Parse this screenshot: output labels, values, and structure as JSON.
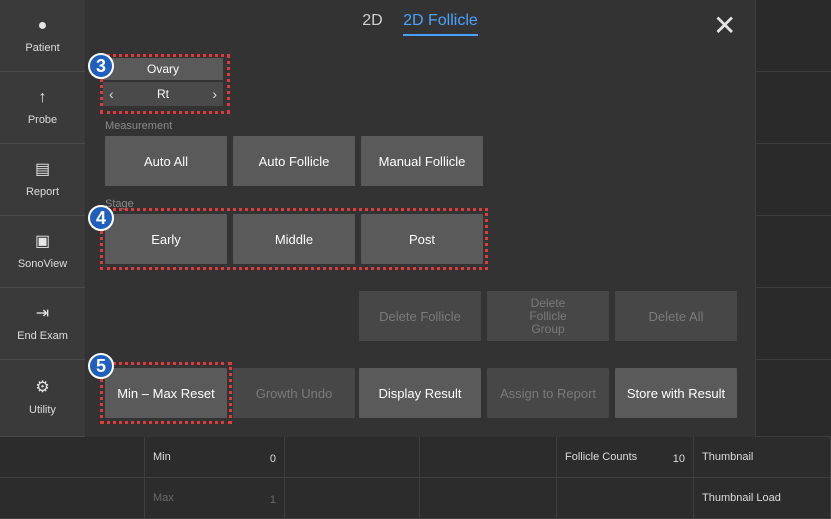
{
  "sidebar": {
    "items": [
      {
        "label": "Patient",
        "icon": "person-icon"
      },
      {
        "label": "Probe",
        "icon": "probe-icon"
      },
      {
        "label": "Report",
        "icon": "document-icon"
      },
      {
        "label": "SonoView",
        "icon": "sonoview-icon"
      },
      {
        "label": "End Exam",
        "icon": "exit-icon"
      },
      {
        "label": "Utility",
        "icon": "gear-icon"
      }
    ]
  },
  "header": {
    "tabs": [
      "2D",
      "2D Follicle"
    ],
    "active_tab": "2D Follicle"
  },
  "ovary": {
    "title": "Ovary",
    "value": "Rt"
  },
  "measurement": {
    "label": "Measurement",
    "buttons": [
      "Auto All",
      "Auto Follicle",
      "Manual Follicle"
    ]
  },
  "stage": {
    "label": "Stage",
    "buttons": [
      "Early",
      "Middle",
      "Post"
    ]
  },
  "delete": {
    "buttons": [
      "Delete Follicle",
      "Delete Follicle Group",
      "Delete All"
    ]
  },
  "actions": {
    "buttons": [
      "Min – Max Reset",
      "Growth Undo",
      "Display Result",
      "Assign to Report",
      "Store with Result"
    ]
  },
  "badges": [
    "3",
    "4",
    "5"
  ],
  "bottom": {
    "min_label": "Min",
    "min_value": "0",
    "max_label": "Max",
    "max_value": "1",
    "follicle_counts_label": "Follicle Counts",
    "follicle_counts_value": "10",
    "thumbnail_label": "Thumbnail",
    "thumbnail_load_label": "Thumbnail Load"
  },
  "colors": {
    "accent": "#4aa3ff",
    "highlight": "#e23b3b",
    "badge": "#1f5fbf"
  }
}
